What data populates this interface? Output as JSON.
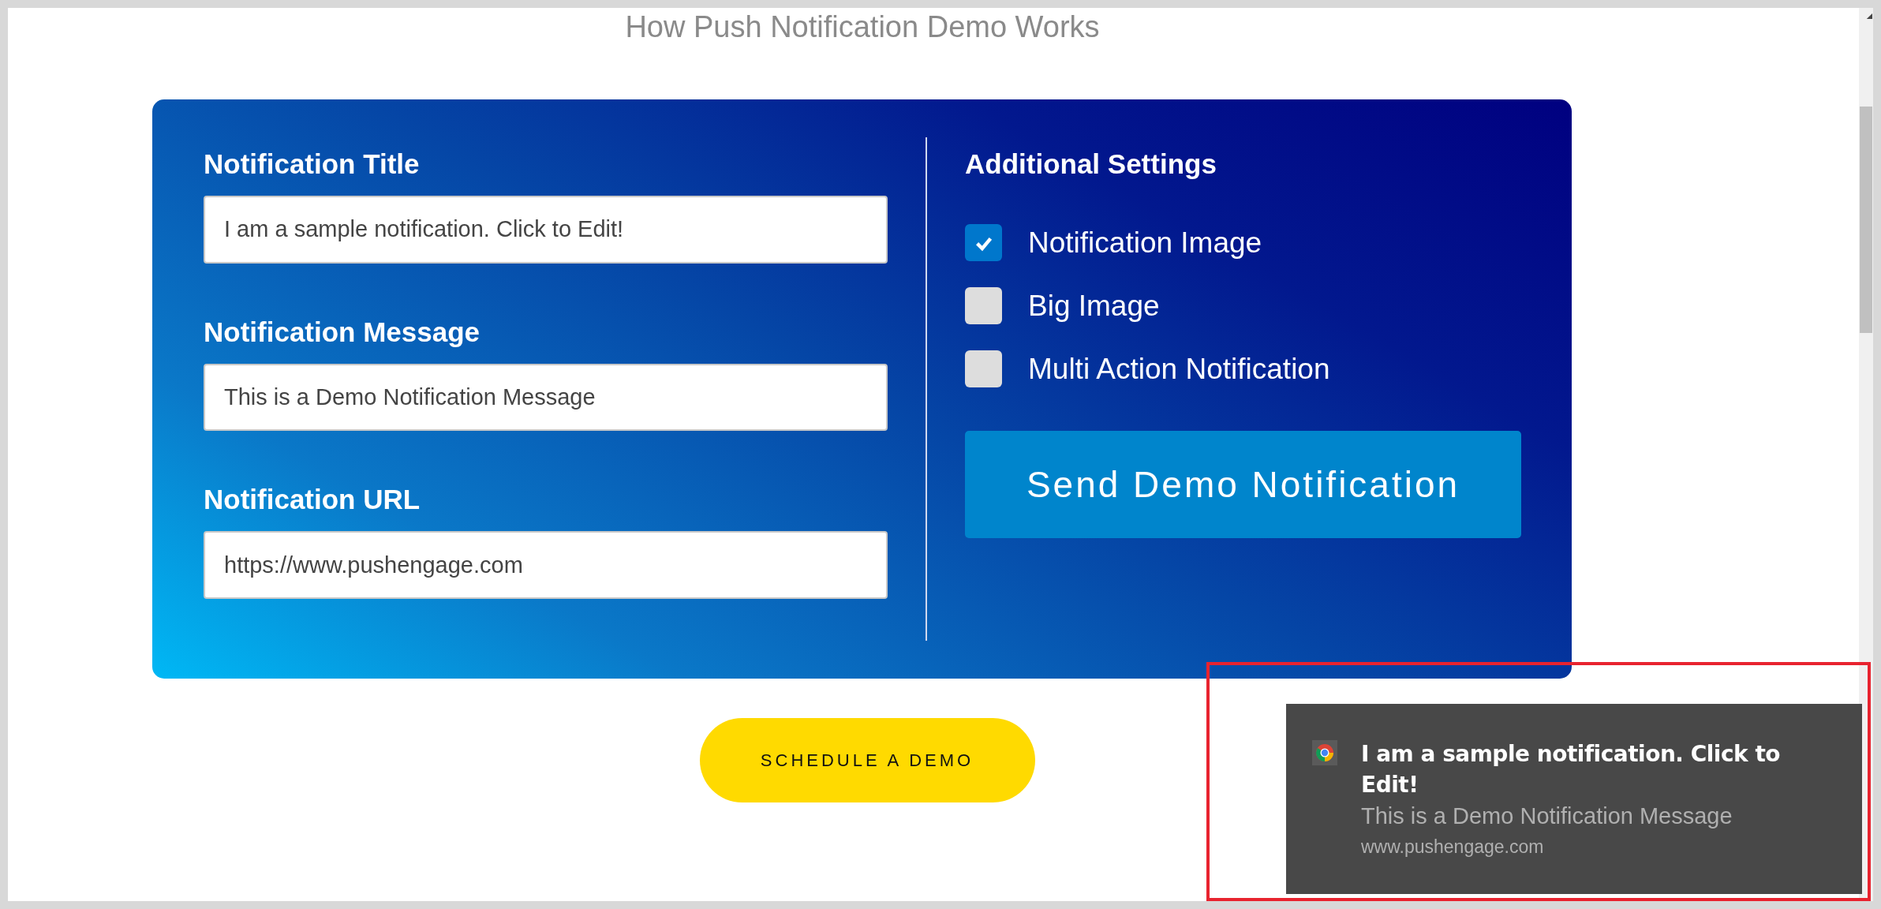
{
  "page_title": "How Push Notification Demo Works",
  "fields": [
    {
      "label": "Notification Title",
      "value": "I am a sample notification. Click to Edit!"
    },
    {
      "label": "Notification Message",
      "value": "This is a Demo Notification Message"
    },
    {
      "label": "Notification URL",
      "value": "https://www.pushengage.com"
    }
  ],
  "settings": {
    "title": "Additional Settings",
    "options": [
      {
        "label": "Notification Image",
        "checked": true
      },
      {
        "label": "Big Image",
        "checked": false
      },
      {
        "label": "Multi Action Notification",
        "checked": false
      }
    ],
    "send_button": "Send Demo Notification"
  },
  "schedule_button": "SCHEDULE A DEMO",
  "notification": {
    "title": "I am a sample notification. Click to Edit!",
    "message": "This is a Demo Notification Message",
    "url": "www.pushengage.com"
  }
}
